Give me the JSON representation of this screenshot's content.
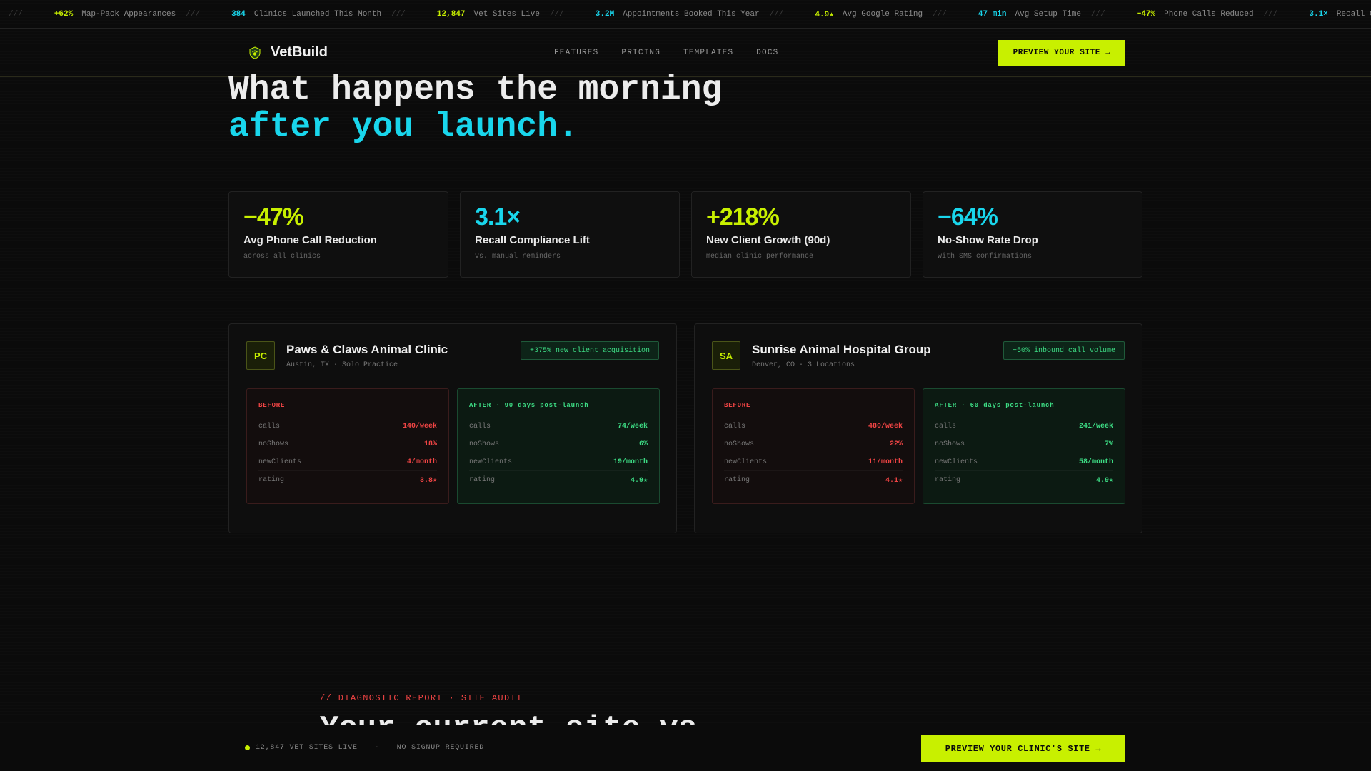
{
  "ticker": [
    {
      "value": "+62%",
      "label": "Map-Pack Appearances",
      "color": "lime"
    },
    {
      "value": "384",
      "label": "Clinics Launched This Month",
      "color": "cyan"
    },
    {
      "value": "12,847",
      "label": "Vet Sites Live",
      "color": "lime"
    },
    {
      "value": "3.2M",
      "label": "Appointments Booked This Year",
      "color": "cyan"
    },
    {
      "value": "4.9★",
      "label": "Avg Google Rating",
      "color": "lime"
    },
    {
      "value": "47 min",
      "label": "Avg Setup Time",
      "color": "cyan"
    },
    {
      "value": "−47%",
      "label": "Phone Calls Reduced",
      "color": "lime"
    },
    {
      "value": "3.1×",
      "label": "Recall Compliance",
      "color": "cyan"
    }
  ],
  "ticker_separator": "///",
  "nav": {
    "brand": "VetBuild",
    "links": [
      "FEATURES",
      "PRICING",
      "TEMPLATES",
      "DOCS"
    ],
    "cta": "PREVIEW YOUR SITE →"
  },
  "hero": {
    "line1": "What happens the morning",
    "line2": "after you launch."
  },
  "stats": [
    {
      "value": "−47%",
      "title": "Avg Phone Call Reduction",
      "sub": "across all clinics",
      "color": "#c8f000"
    },
    {
      "value": "3.1×",
      "title": "Recall Compliance Lift",
      "sub": "vs. manual reminders",
      "color": "#19d6ec"
    },
    {
      "value": "+218%",
      "title": "New Client Growth (90d)",
      "sub": "median clinic performance",
      "color": "#c8f000"
    },
    {
      "value": "−64%",
      "title": "No-Show Rate Drop",
      "sub": "with SMS confirmations",
      "color": "#19d6ec"
    }
  ],
  "cases": [
    {
      "initials": "PC",
      "name": "Paws & Claws Animal Clinic",
      "location": "Austin, TX · Solo Practice",
      "badge": "+375% new client acquisition",
      "before": {
        "title": "BEFORE",
        "rows": [
          {
            "k": "calls",
            "v": "140/week"
          },
          {
            "k": "noShows",
            "v": "18%"
          },
          {
            "k": "newClients",
            "v": "4/month"
          },
          {
            "k": "rating",
            "v": "3.8★"
          }
        ]
      },
      "after": {
        "title": "AFTER · 90 days post-launch",
        "rows": [
          {
            "k": "calls",
            "v": "74/week"
          },
          {
            "k": "noShows",
            "v": "6%"
          },
          {
            "k": "newClients",
            "v": "19/month"
          },
          {
            "k": "rating",
            "v": "4.9★"
          }
        ]
      }
    },
    {
      "initials": "SA",
      "name": "Sunrise Animal Hospital Group",
      "location": "Denver, CO · 3 Locations",
      "badge": "−50% inbound call volume",
      "before": {
        "title": "BEFORE",
        "rows": [
          {
            "k": "calls",
            "v": "480/week"
          },
          {
            "k": "noShows",
            "v": "22%"
          },
          {
            "k": "newClients",
            "v": "11/month"
          },
          {
            "k": "rating",
            "v": "4.1★"
          }
        ]
      },
      "after": {
        "title": "AFTER · 60 days post-launch",
        "rows": [
          {
            "k": "calls",
            "v": "241/week"
          },
          {
            "k": "noShows",
            "v": "7%"
          },
          {
            "k": "newClients",
            "v": "58/month"
          },
          {
            "k": "rating",
            "v": "4.9★"
          }
        ]
      }
    }
  ],
  "diagnostic": {
    "label": "// DIAGNOSTIC REPORT · SITE AUDIT",
    "title": "Your current site vs."
  },
  "bottom_bar": {
    "live_text": "12,847 VET SITES LIVE",
    "separator": "·",
    "no_signup": "NO SIGNUP REQUIRED",
    "cta": "PREVIEW YOUR CLINIC'S SITE →"
  },
  "colors": {
    "lime": "#c8f000",
    "cyan": "#19d6ec",
    "red": "#ef4444",
    "green": "#3ddc84",
    "background": "#0b0b0b"
  },
  "icons": {
    "brand": "shield-paw-icon",
    "live": "status-dot-icon"
  }
}
